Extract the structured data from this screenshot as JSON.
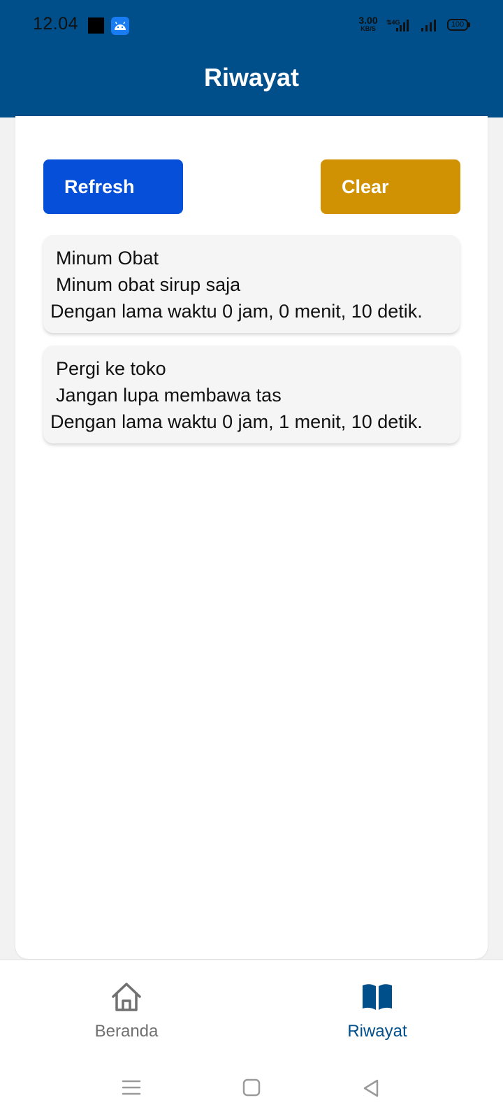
{
  "status_bar": {
    "time": "12.04",
    "speed_value": "3.00",
    "speed_unit": "KB/S",
    "network": "4G",
    "battery": "100"
  },
  "header": {
    "title": "Riwayat"
  },
  "actions": {
    "refresh_label": "Refresh",
    "clear_label": "Clear"
  },
  "history": {
    "items": [
      {
        "title": "Minum Obat",
        "note": "Minum obat sirup saja",
        "duration": "Dengan lama waktu 0 jam, 0 menit, 10 detik."
      },
      {
        "title": "Pergi ke toko",
        "note": "Jangan lupa membawa tas",
        "duration": "Dengan lama waktu 0 jam, 1 menit, 10 detik."
      }
    ]
  },
  "bottom_nav": {
    "items": [
      {
        "label": "Beranda",
        "icon": "home-icon"
      },
      {
        "label": "Riwayat",
        "icon": "book-icon",
        "active": true
      }
    ]
  },
  "colors": {
    "primary": "#004f8a",
    "refresh_button": "#064fd8",
    "clear_button": "#d09202",
    "card_background": "#f5f5f5"
  }
}
